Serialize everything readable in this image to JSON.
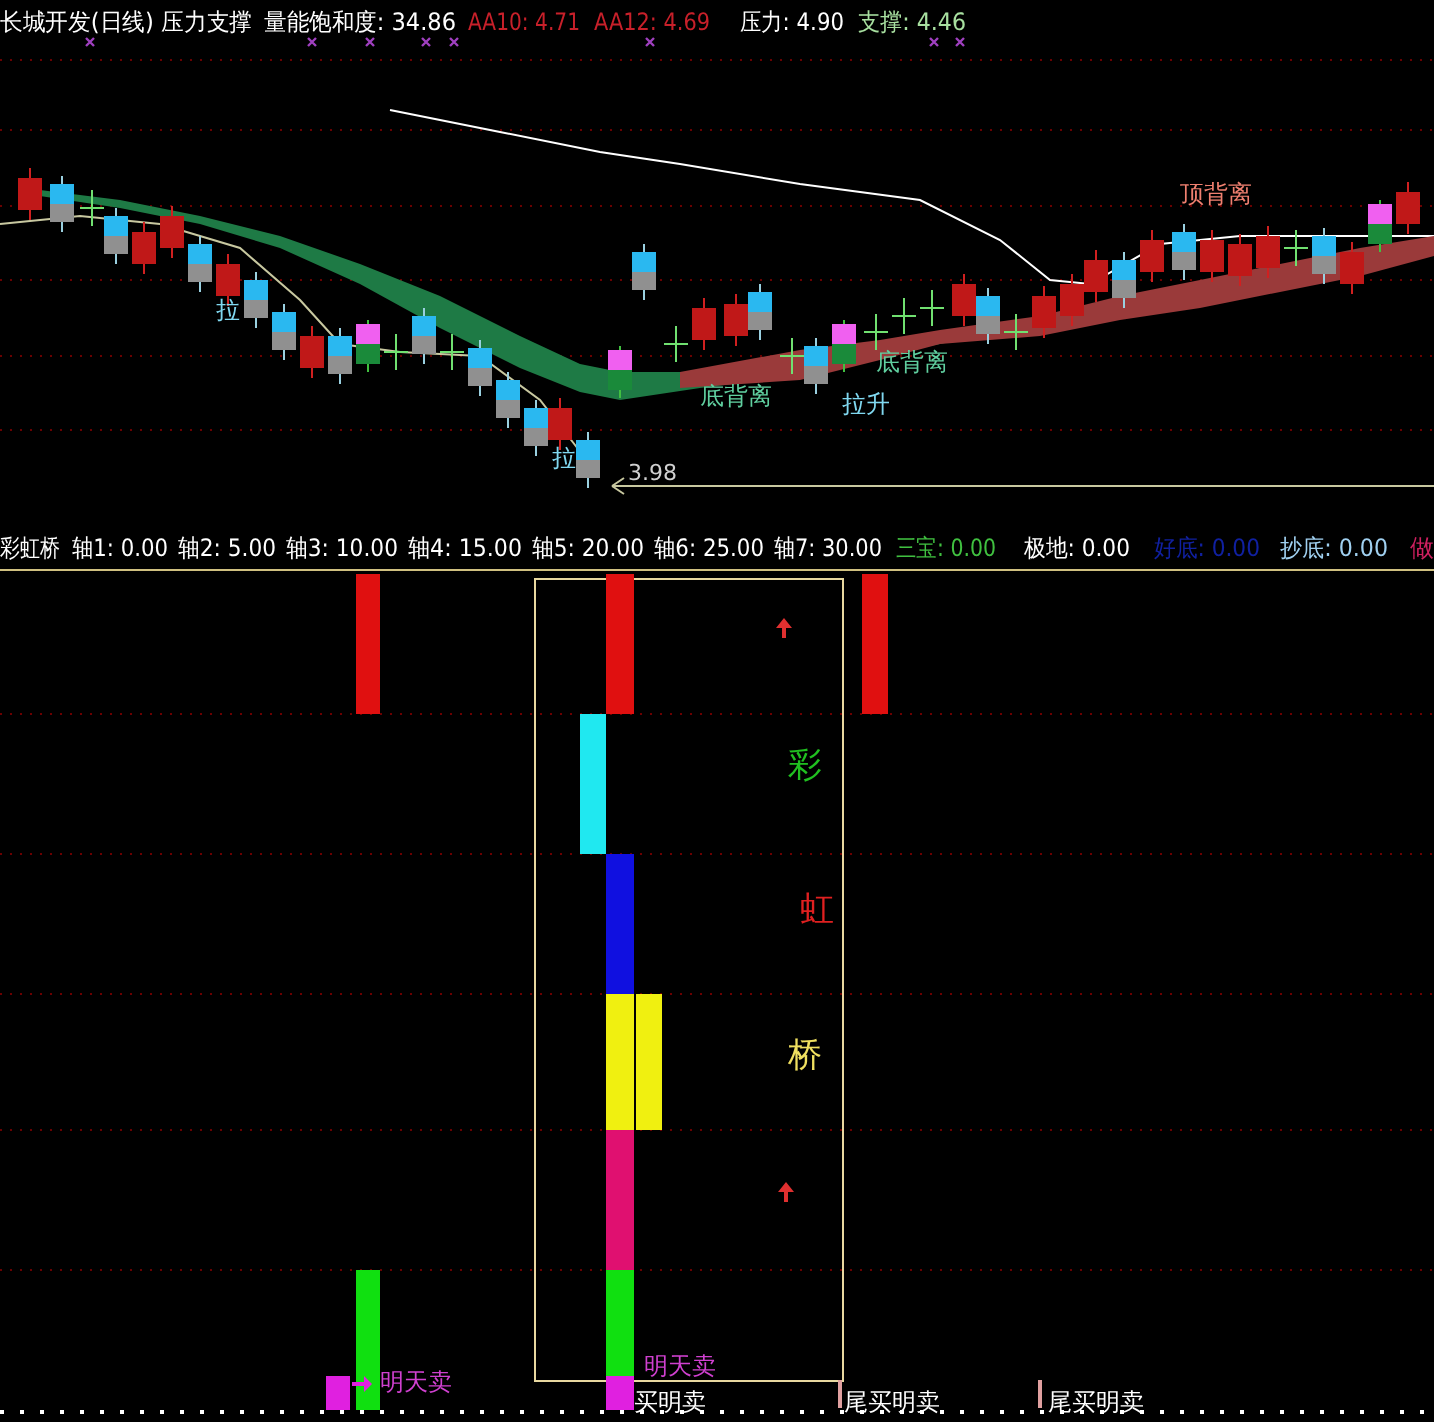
{
  "price_panel": {
    "title": "长城开发(日线) 压力支撑",
    "indicators": [
      {
        "label": "量能饱和度: 34.86",
        "color": "#ffffff"
      },
      {
        "label": "AA10: 4.71",
        "color": "#c8202a"
      },
      {
        "label": "AA12: 4.69",
        "color": "#c8202a"
      },
      {
        "label": "压力: 4.90",
        "color": "#ffffff"
      },
      {
        "label": "支撑: 4.46",
        "color": "#a8e0a0"
      }
    ],
    "annotations": [
      {
        "text": "顶背离",
        "kind": "top_divergence"
      },
      {
        "text": "底背离",
        "kind": "bottom_divergence"
      },
      {
        "text": "底背离",
        "kind": "bottom_divergence"
      },
      {
        "text": "拉升",
        "kind": "pull_up"
      },
      {
        "text": "拉",
        "kind": "pull_up"
      },
      {
        "text": "拉",
        "kind": "pull_up"
      }
    ],
    "low_marker": "3.98"
  },
  "rainbow_panel": {
    "title": "彩虹桥",
    "readings": [
      {
        "label": "轴1: 0.00",
        "color": "#ffffff"
      },
      {
        "label": "轴2: 5.00",
        "color": "#ffffff"
      },
      {
        "label": "轴3: 10.00",
        "color": "#ffffff"
      },
      {
        "label": "轴4: 15.00",
        "color": "#ffffff"
      },
      {
        "label": "轴5: 20.00",
        "color": "#ffffff"
      },
      {
        "label": "轴6: 25.00",
        "color": "#ffffff"
      },
      {
        "label": "轴7: 30.00",
        "color": "#ffffff"
      },
      {
        "label": "三宝: 0.00",
        "color": "#40c040"
      },
      {
        "label": "极地: 0.00",
        "color": "#ffffff"
      },
      {
        "label": "好底: 0.00",
        "color": "#1020a0"
      },
      {
        "label": "抄底: 0.00",
        "color": "#a0d0f0"
      },
      {
        "label": "做",
        "color": "#d02060"
      }
    ],
    "chart_labels": [
      {
        "text": "彩",
        "color": "#20c020"
      },
      {
        "text": "虹",
        "color": "#e02020"
      },
      {
        "text": "桥",
        "color": "#f0e060"
      }
    ],
    "signals": [
      {
        "text": "明天卖",
        "kind": "sell"
      },
      {
        "text": "明天卖",
        "kind": "sell"
      },
      {
        "text": "买明卖",
        "kind": "buy_sell"
      },
      {
        "text": "尾买明卖",
        "kind": "buy_sell"
      },
      {
        "text": "尾买明卖",
        "kind": "buy_sell"
      }
    ]
  }
}
